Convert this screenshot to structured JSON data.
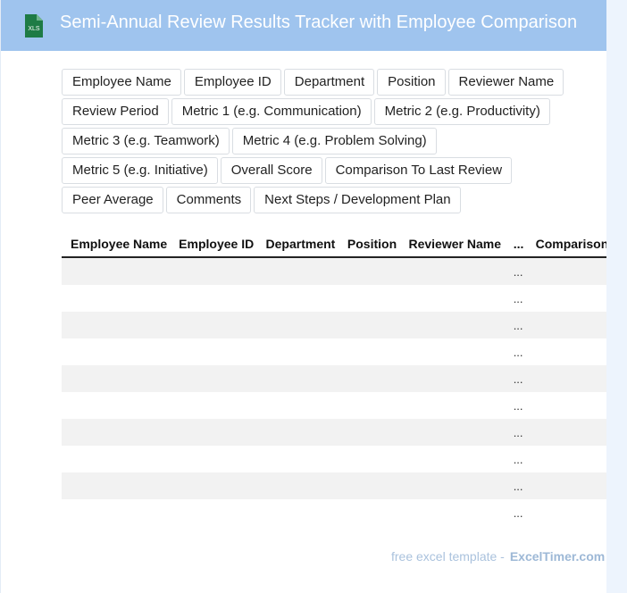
{
  "header": {
    "title": "Semi-Annual Review Results Tracker with Employee Comparison",
    "icon_label": "XLS",
    "icon_color": "#1e7b45",
    "bg_color": "#9fc4ee"
  },
  "fields": [
    "Employee Name",
    "Employee ID",
    "Department",
    "Position",
    "Reviewer Name",
    "Review Period",
    "Metric 1 (e.g. Communication)",
    "Metric 2 (e.g. Productivity)",
    "Metric 3 (e.g. Teamwork)",
    "Metric 4 (e.g. Problem Solving)",
    "Metric 5 (e.g. Initiative)",
    "Overall Score",
    "Comparison To Last Review",
    "Peer Average",
    "Comments",
    "Next Steps / Development Plan"
  ],
  "table": {
    "columns": [
      "Employee Name",
      "Employee ID",
      "Department",
      "Position",
      "Reviewer Name",
      "...",
      "Comparison To Last Review"
    ],
    "ellipsis": "...",
    "row_count": 10
  },
  "footer": {
    "text": "free excel template -",
    "brand": "ExcelTimer.com"
  }
}
